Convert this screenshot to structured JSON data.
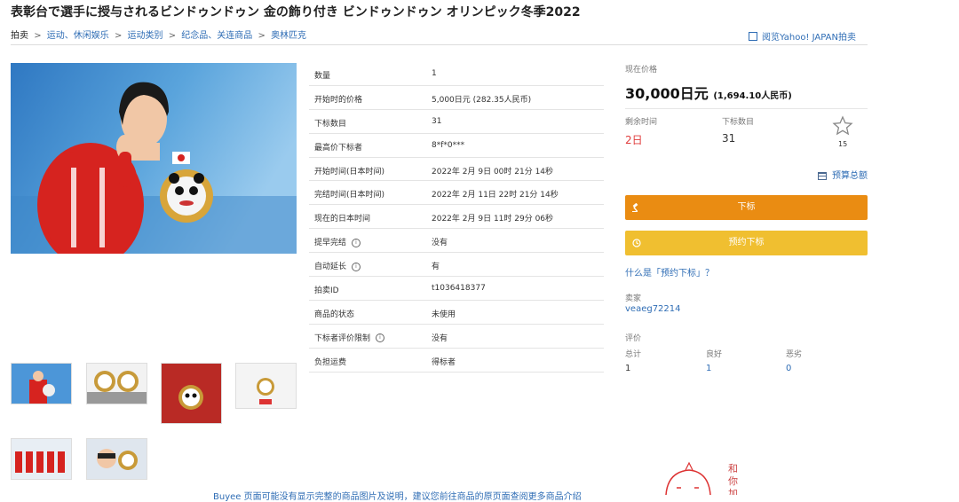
{
  "title": "表彰台で選手に授与されるビンドゥンドゥン 金の飾り付き ビンドゥンドゥン オリンピック冬季2022",
  "breadcrumb": {
    "root": "拍卖",
    "separator": ">",
    "items": [
      "运动、休闲娱乐",
      "运动类别",
      "纪念品、关连商品",
      "奥林匹克"
    ]
  },
  "yahoo_link": "阅览Yahoo! JAPAN拍卖",
  "specs": [
    {
      "label": "数量",
      "value": "1"
    },
    {
      "label": "开始时的价格",
      "value": "5,000日元 (282.35人民币)"
    },
    {
      "label": "下标数目",
      "value": "31"
    },
    {
      "label": "最高价下标者",
      "value": "8*f*0***"
    },
    {
      "label": "开始时间(日本时间)",
      "value": "2022年 2月 9日 00时 21分 14秒"
    },
    {
      "label": "完结时间(日本时间)",
      "value": "2022年 2月 11日 22时 21分 14秒"
    },
    {
      "label": "现在的日本时间",
      "value": "2022年 2月 9日 11时 29分 06秒"
    },
    {
      "label": "提早完结",
      "value": "没有",
      "info": true
    },
    {
      "label": "自动延长",
      "value": "有",
      "info": true
    },
    {
      "label": "拍卖ID",
      "value": "t1036418377"
    },
    {
      "label": "商品的状态",
      "value": "未使用"
    },
    {
      "label": "下标者评价限制",
      "value": "没有",
      "info": true
    },
    {
      "label": "负担运费",
      "value": "得标者"
    }
  ],
  "info_glyph": "i",
  "price_panel": {
    "current_label": "现在价格",
    "price": "30,000日元",
    "price_rmb": "(1,694.10人民币)",
    "time_left_label": "剩余时间",
    "time_left": "2日",
    "bid_count_label": "下标数目",
    "bid_count": "31",
    "watch_count": "15",
    "budget_link": "预算总额",
    "bid_button": "下标",
    "reserve_button": "预约下标",
    "what_reserve_link": "什么是「预约下标」？",
    "seller_label": "卖家",
    "seller": "veaeg72214",
    "rating_label": "评价",
    "rating": [
      {
        "label": "总计",
        "value": "1"
      },
      {
        "label": "良好",
        "value": "1"
      },
      {
        "label": "恶劣",
        "value": "0"
      }
    ]
  },
  "footer_text": "Buyee 页面可能没有显示完整的商品图片及说明，建议您前往商品的原页面查阅更多商品介绍",
  "mascot_text": "和你加",
  "colors": {
    "link": "#2f6db5",
    "bid_button": "#ea8c12",
    "reserve_button": "#f0bf30",
    "time_left": "#e03b3b"
  }
}
